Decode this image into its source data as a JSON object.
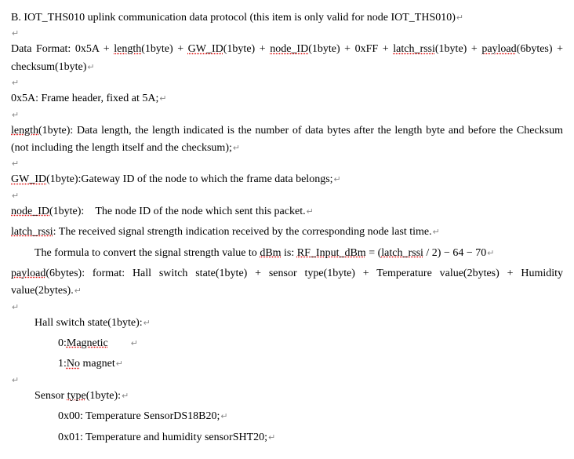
{
  "title": "B. IOT_THS010 uplink communication data protocol (this item is only valid for node IOT_THS010)",
  "dataFormat": {
    "prefix": "Data Format: 0x5A + ",
    "length": "length",
    "lengthSuffix": "(1byte) + ",
    "gw": "GW_ID",
    "gwSuffix": "(1byte) + ",
    "nodeid": "node_ID",
    "nodeidSuffix": "(1byte) + 0xFF + ",
    "latch": "latch_rssi",
    "latchSuffix": "(1byte) + ",
    "payload": "payload",
    "payloadSuffix": "(6bytes) + checksum(1byte)"
  },
  "frameHeader": "0x5A: Frame header, fixed at 5A;",
  "lengthDesc": {
    "label": "length",
    "labelSuffix": "(1byte): Data length, the length indicated is the number of data bytes after the length byte and before the Checksum (not including the length itself and the checksum);"
  },
  "gwDesc": {
    "label": "GW_ID",
    "labelSuffix": "(1byte):Gateway ID of the node to which the frame data belongs;"
  },
  "nodeIdDesc": {
    "label": "node_ID",
    "labelSuffix": "(1byte):",
    "rest": "The node ID of the node which sent this packet."
  },
  "latchDesc": {
    "label": "latch_rssi",
    "labelSuffix": ": The received signal strength indication received by the corresponding node last time."
  },
  "formulaLine": {
    "prefix": "The formula to convert the signal strength value to ",
    "dbm": "dBm",
    "mid": " is: ",
    "rf": "RF_Input_dBm",
    "eq": " = (",
    "latch": "latch_rssi",
    "suffix": " / 2)  −  64  −  70"
  },
  "payloadDesc": {
    "label": "payload",
    "labelSuffix": "(6bytes): format: Hall switch state(1byte) + sensor type(1byte) + Temperature value(2bytes) + Humidity value(2bytes)."
  },
  "hall": {
    "title": "Hall switch state(1byte):",
    "opt0pre": "0:",
    "opt0": "Magnetic",
    "opt1pre": "1:",
    "opt1": "No",
    "opt1b": " magnet"
  },
  "sensor": {
    "titlePre": "Sensor ",
    "titleU": "type",
    "titleSuffix": "(1byte):",
    "opt0": "0x00: Temperature SensorDS18B20;",
    "opt1": "0x01: Temperature and humidity sensorSHT20;"
  },
  "ret": "↵"
}
